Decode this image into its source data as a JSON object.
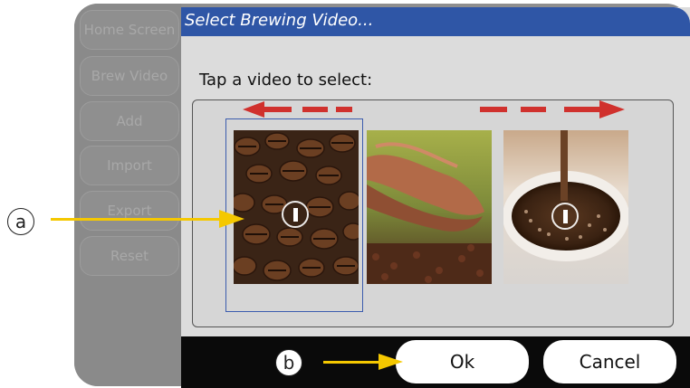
{
  "sidebar": {
    "items": [
      {
        "label": "Home Screen"
      },
      {
        "label": "Brew Video"
      },
      {
        "label": "Add"
      },
      {
        "label": "Import"
      },
      {
        "label": "Export"
      },
      {
        "label": "Reset"
      }
    ]
  },
  "dialog": {
    "title": "Select Brewing Video...",
    "prompt": "Tap a video to select:",
    "videos": [
      {
        "name": "coffee-beans",
        "selected": true
      },
      {
        "name": "hands-beans",
        "selected": false
      },
      {
        "name": "coffee-pour",
        "selected": false
      }
    ],
    "ok_label": "Ok",
    "cancel_label": "Cancel"
  },
  "annotations": {
    "a": "a",
    "b": "b"
  },
  "colors": {
    "title_bar": "#2f56a6",
    "arrow_red": "#d0312d",
    "arrow_yellow": "#f5c800",
    "selection": "#3c5cae"
  }
}
